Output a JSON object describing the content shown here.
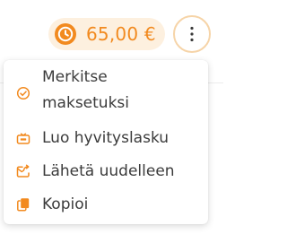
{
  "amount": {
    "value": "65,00 €",
    "icon": "clock-icon",
    "color": "#f28a1f",
    "background": "#fdf0df"
  },
  "more_button": {
    "icon": "more-vertical-icon"
  },
  "menu": {
    "items": [
      {
        "label_line1": "Merkitse",
        "label_line2": "maksetuksi",
        "icon": "check-circle-icon"
      },
      {
        "label": "Luo hyvityslasku",
        "icon": "credit-note-icon"
      },
      {
        "label": "Lähetä uudelleen",
        "icon": "resend-icon"
      },
      {
        "label": "Kopioi",
        "icon": "copy-icon"
      }
    ]
  }
}
